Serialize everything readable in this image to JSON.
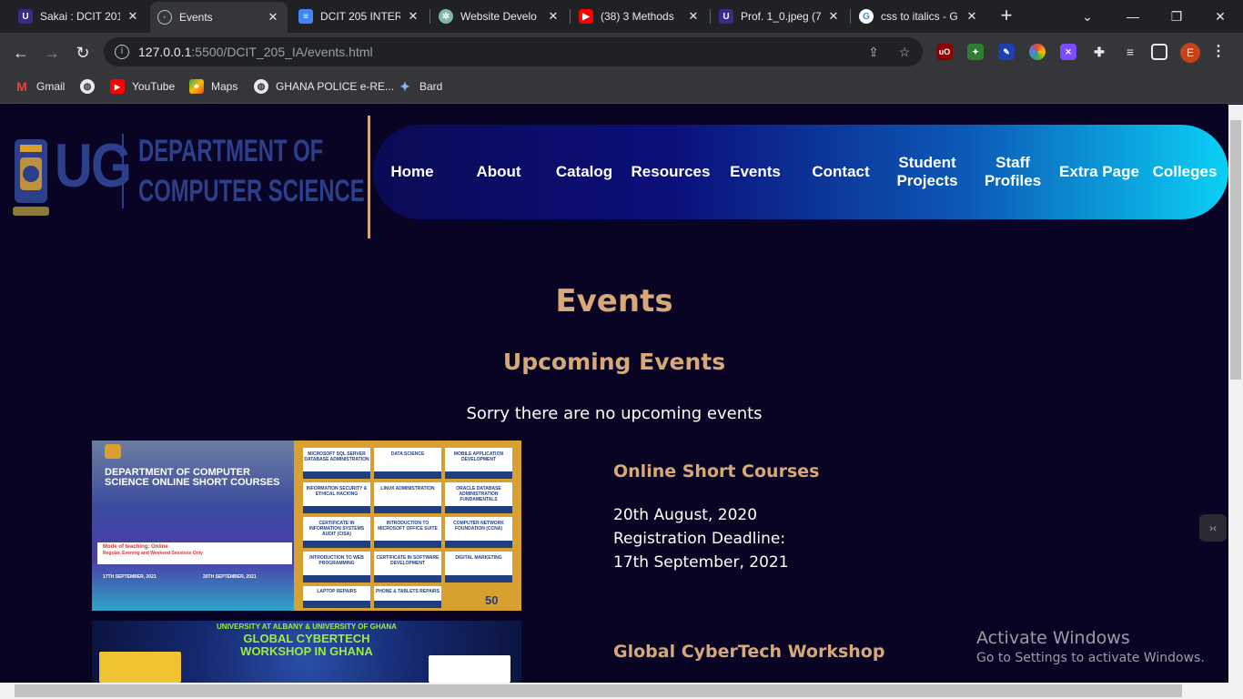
{
  "browser": {
    "tabs": [
      {
        "title": "Sakai : DCIT 201",
        "favicon": "ug-icon",
        "color": "#3b2a8a"
      },
      {
        "title": "Events",
        "favicon": "globe-icon",
        "color": "#5f6368",
        "active": true
      },
      {
        "title": "DCIT 205 INTER",
        "favicon": "docs-icon",
        "color": "#4285f4"
      },
      {
        "title": "Website Develo",
        "favicon": "chatgpt-icon",
        "color": "#7fb8a8"
      },
      {
        "title": "(38) 3 Methods",
        "favicon": "youtube-icon",
        "color": "#ff0000"
      },
      {
        "title": "Prof. 1_0.jpeg (7",
        "favicon": "ug-icon",
        "color": "#3b2a8a"
      },
      {
        "title": "css to italics - G",
        "favicon": "google-icon",
        "color": "#ffffff"
      }
    ],
    "address": {
      "host": "127.0.0.1",
      "path": ":5500/DCIT_205_IA/events.html"
    },
    "profile_initial": "E",
    "bookmarks": [
      "Gmail",
      "",
      "YouTube",
      "Maps",
      "GHANA POLICE e-RE...",
      "Bard"
    ]
  },
  "site": {
    "logo": {
      "mark": "UG",
      "line1": "DEPARTMENT OF",
      "line2": "COMPUTER SCIENCE"
    },
    "nav": [
      "Home",
      "About",
      "Catalog",
      "Resources",
      "Events",
      "Contact",
      "Student Projects",
      "Staff Profiles",
      "Extra Page",
      "Colleges"
    ]
  },
  "main": {
    "title": "Events",
    "subtitle": "Upcoming Events",
    "notice": "Sorry there are no upcoming events",
    "events": [
      {
        "title": "Online Short Courses",
        "date": "20th August, 2020",
        "deadline_label": "Registration Deadline:",
        "deadline": "17th September, 2021",
        "poster": {
          "head": "DEPARTMENT OF COMPUTER SCIENCE ONLINE SHORT COURSES",
          "courses": [
            "MICROSOFT SQL SERVER DATABASE ADMINISTRATION",
            "DATA SCIENCE",
            "MOBILE APPLICATION DEVELOPMENT",
            "INFORMATION SECURITY & ETHICAL HACKING",
            "LINUX ADMINISTRATION",
            "ORACLE DATABASE ADMINISTRATION FUNDAMENTALS",
            "CERTIFICATE IN INFORMATION SYSTEMS AUDIT (CISA)",
            "INTRODUCTION TO MICROSOFT OFFICE SUITE",
            "COMPUTER NETWORK FOUNDATION (CCNA)",
            "INTRODUCTION TO WEB PROGRAMMING",
            "CERTIFICATE IN SOFTWARE DEVELOPMENT",
            "DIGITAL MARKETING"
          ],
          "prices": [
            "GH₵ 995.00",
            "GH₵ 1,500.00",
            "GH₵ 1,000.00",
            "GH₵ 995.00",
            "GH₵ 995.00",
            "GH₵ 995.00",
            "GH₵ 995.00",
            "GH₵ 750.00",
            "GH₵ 950.00",
            "GH₵ 900.00",
            "GH₵ 1,500.00",
            "GH₵ 900.00"
          ],
          "mode": "Mode of teaching: Online",
          "sessions": "Regular, Evening and Weekend Sessions Only",
          "reg": "17TH SEPTEMBER, 2021",
          "start": "20TH SEPTEMBER, 2021",
          "extra1": "LAPTOP REPAIRS",
          "extra2": "PHONE & TABLETS REPAIRS",
          "reg_fee": "50"
        }
      },
      {
        "title": "Global CyberTech Workshop",
        "poster": {
          "line1": "UNIVERSITY AT ALBANY & UNIVERSITY OF GHANA",
          "line2": "GLOBAL CYBERTECH",
          "line3": "WORKSHOP IN GHANA"
        }
      }
    ]
  },
  "os": {
    "watermark_title": "Activate Windows",
    "watermark_sub": "Go to Settings to activate Windows."
  }
}
